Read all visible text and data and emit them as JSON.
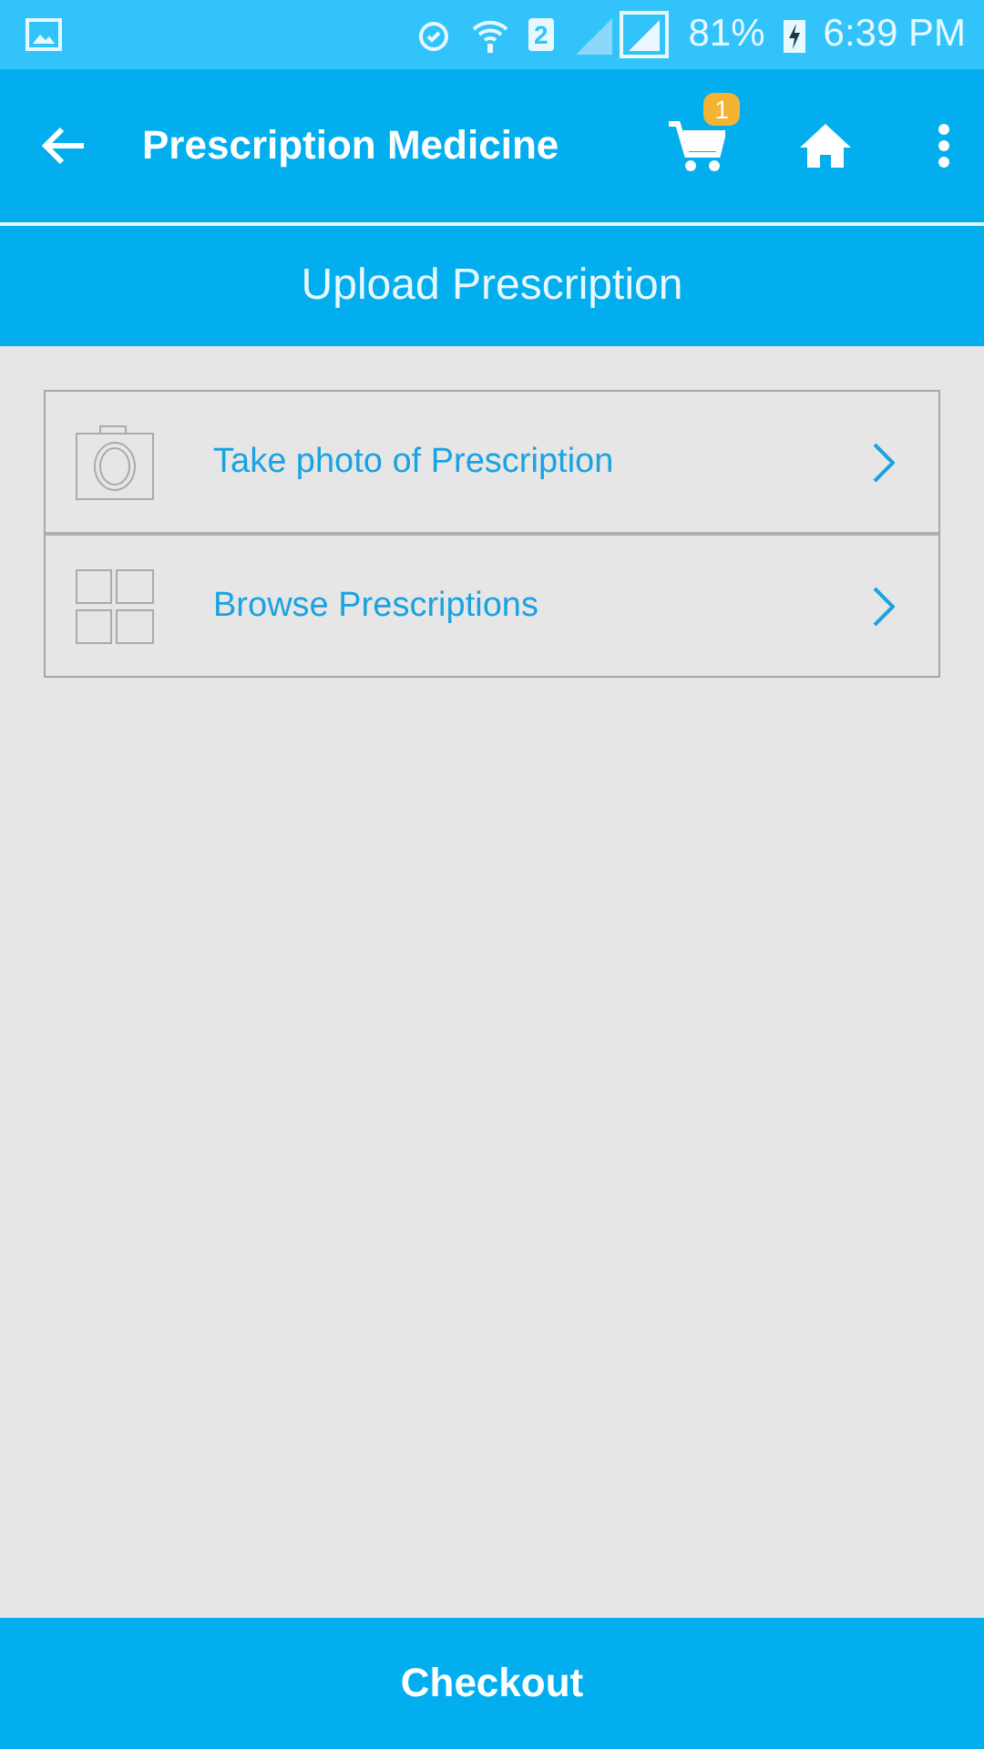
{
  "status_bar": {
    "sim": "2",
    "battery": "81%",
    "time": "6:39 PM"
  },
  "app_bar": {
    "title": "Prescription Medicine",
    "cart_count": "1"
  },
  "section_title": "Upload Prescription",
  "options": [
    {
      "kind": "camera",
      "label": "Take photo of Prescription"
    },
    {
      "kind": "grid",
      "label": "Browse Prescriptions"
    }
  ],
  "checkout": "Checkout"
}
